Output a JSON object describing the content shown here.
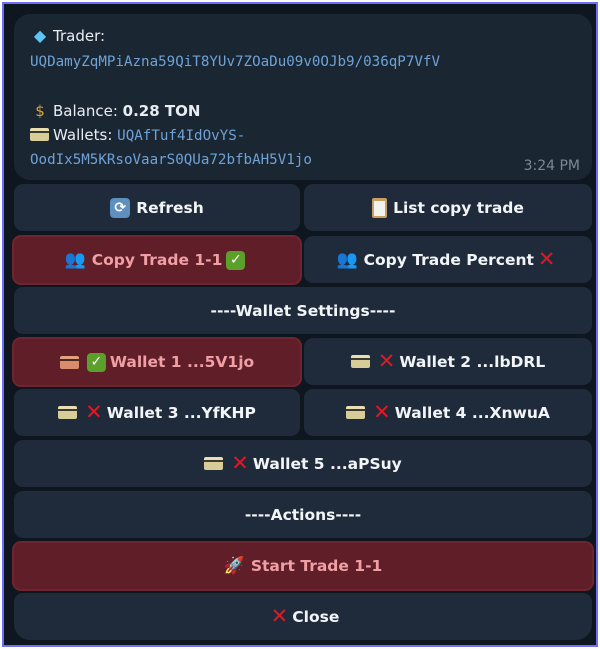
{
  "message": {
    "trader_label": "Trader:",
    "trader_address": "UQDamyZqMPiAzna59QiT8YUv7ZOaDu09v0OJb9/036qP7VfV",
    "balance_label": "Balance:",
    "balance_value": "0.28 TON",
    "wallets_label": "Wallets:",
    "wallets_address_line1": "UQAfTuf4IdOvYS-",
    "wallets_address_line2": "OodIx5M5KRsoVaarS0QUa72bfbAH5V1jo",
    "time": "3:24 PM",
    "icons": {
      "trader": "diamond-icon",
      "balance": "money-bag-icon",
      "wallets": "credit-card-icon"
    }
  },
  "keyboard": {
    "refresh": "Refresh",
    "list_copy_trade": "List copy trade",
    "copy_trade_1_1": "Copy Trade 1-1",
    "copy_trade_percent": "Copy Trade Percent",
    "wallet_settings_header": "----Wallet Settings----",
    "wallets": [
      {
        "label": "Wallet 1 ...5V1jo",
        "enabled": true
      },
      {
        "label": "Wallet 2 ...lbDRL",
        "enabled": false
      },
      {
        "label": "Wallet 3 ...YfKHP",
        "enabled": false
      },
      {
        "label": "Wallet 4 ...XnwuA",
        "enabled": false
      },
      {
        "label": "Wallet 5 ...aPSuy",
        "enabled": false
      }
    ],
    "actions_header": "----Actions----",
    "start_trade": "Start Trade 1-1",
    "close": "Close",
    "glyphs": {
      "check": "✓",
      "cross": "✕",
      "refresh": "⟳",
      "users": "👥",
      "rocket": "🚀",
      "diamond": "◆",
      "moneybag": "$"
    },
    "colors": {
      "active_bg": "#5f1e28",
      "button_bg": "#1f2b3a",
      "link": "#6ea2d6"
    }
  }
}
